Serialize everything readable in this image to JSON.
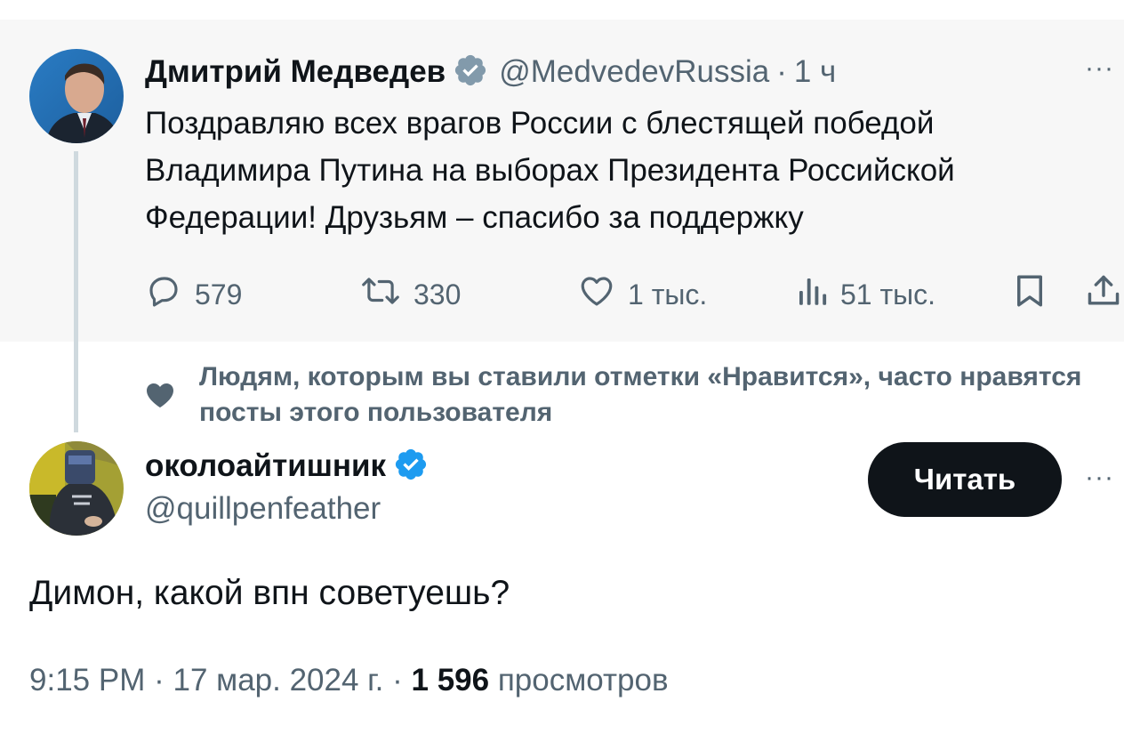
{
  "parent_tweet": {
    "display_name": "Дмитрий Медведев",
    "verified_badge": "gray-verified-icon",
    "handle": "@MedvedevRussia",
    "separator": "·",
    "time": "1 ч",
    "more": "···",
    "text": "Поздравляю всех врагов России с блестящей победой Владимира Путина на выборах Президента Российской Федерации! Друзьям – спасибо за поддержку",
    "actions": {
      "replies": "579",
      "retweets": "330",
      "likes": "1 тыс.",
      "views": "51 тыс."
    }
  },
  "social_context": {
    "text": "Людям, которым вы ставили отметки «Нравится», часто нравятся посты этого пользователя"
  },
  "reply_tweet": {
    "display_name": "околоайтишник",
    "verified_badge": "blue-verified-icon",
    "handle": "@quillpenfeather",
    "follow_label": "Читать",
    "more": "···",
    "text": "Димон, какой впн советуешь?",
    "meta": {
      "time": "9:15 PM",
      "sep1": "·",
      "date": "17 мар. 2024 г.",
      "sep2": "·",
      "views_count": "1 596",
      "views_label": "просмотров"
    }
  },
  "colors": {
    "text_primary": "#0f1419",
    "text_secondary": "#536471",
    "card_background": "#f7f7f7",
    "verified_blue": "#1d9bf0",
    "verified_gray": "#829aab",
    "thread_line": "#cfd9de",
    "button_background": "#0f1419"
  }
}
